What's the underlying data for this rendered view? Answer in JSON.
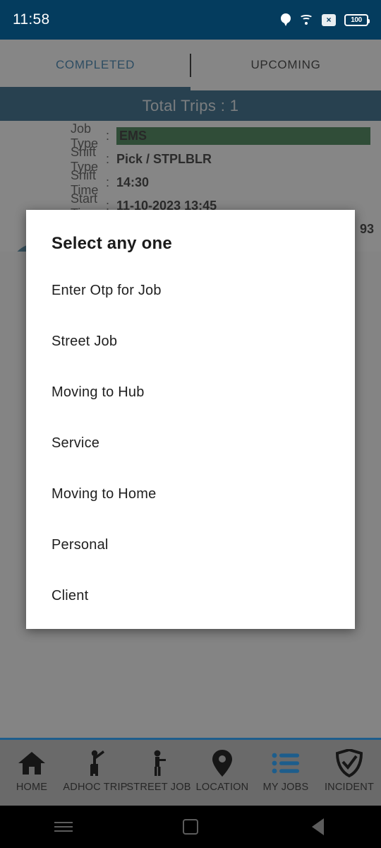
{
  "statusbar": {
    "time": "11:58",
    "icons": [
      "location-pin-icon",
      "wifi-icon",
      "no-sim-icon",
      "battery-icon"
    ],
    "sim_glyph": "×",
    "battery_level": "100",
    "background_color": "#043c5e"
  },
  "tabs": [
    {
      "label": "COMPLETED",
      "active": true,
      "color": "#1466a0"
    },
    {
      "label": "UPCOMING",
      "active": false,
      "color": "#111111"
    }
  ],
  "header": {
    "total_trips_label": "Total Trips : 1",
    "background_color": "#0a4a72"
  },
  "trip_card": {
    "status_icon": "checked-checkbox-icon",
    "rows": [
      {
        "label": "Job Type",
        "sep": ":",
        "value": "EMS",
        "highlight": true,
        "highlight_color": "#1d6b33"
      },
      {
        "label": "Shift Type",
        "sep": ":",
        "value": "Pick / STPLBLR",
        "highlight": false
      },
      {
        "label": "Shift Time",
        "sep": ":",
        "value": "14:30",
        "highlight": false
      },
      {
        "label": "Start Time",
        "sep": ":",
        "value": "11-10-2023 13:45",
        "highlight": false
      }
    ],
    "partial_value_right": "93"
  },
  "dialog": {
    "title": "Select any one",
    "items": [
      {
        "label": "Enter Otp for Job"
      },
      {
        "label": "Street Job"
      },
      {
        "label": "Moving to Hub"
      },
      {
        "label": "Service"
      },
      {
        "label": "Moving to Home"
      },
      {
        "label": "Personal"
      },
      {
        "label": "Client"
      }
    ]
  },
  "bottom_nav": [
    {
      "label": "HOME",
      "icon": "home-icon"
    },
    {
      "label": "ADHOC TRIP",
      "icon": "person-hailing-icon"
    },
    {
      "label": "STREET JOB",
      "icon": "person-standing-icon"
    },
    {
      "label": "LOCATION",
      "icon": "map-pin-icon"
    },
    {
      "label": "MY JOBS",
      "icon": "list-icon",
      "color": "#1d5d8c"
    },
    {
      "label": "INCIDENT",
      "icon": "shield-check-icon"
    }
  ],
  "android_nav": [
    {
      "icon": "recents-icon"
    },
    {
      "icon": "home-square-icon"
    },
    {
      "icon": "back-icon"
    }
  ]
}
